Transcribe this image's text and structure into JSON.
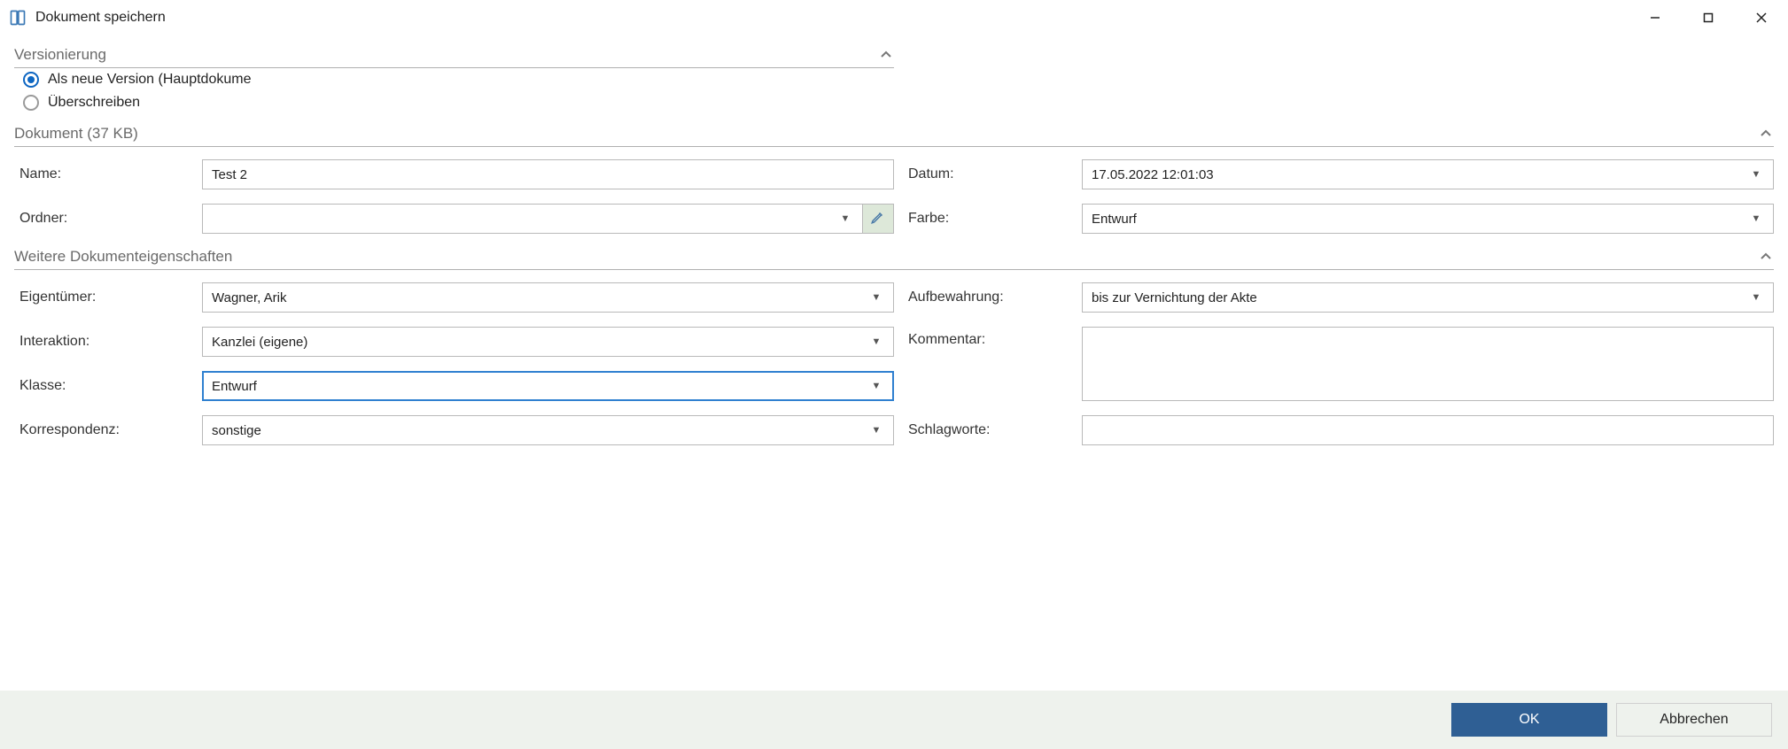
{
  "window": {
    "title": "Dokument speichern"
  },
  "versioning": {
    "title": "Versionierung",
    "option_new_version": "Als neue Version (Hauptdokume",
    "option_overwrite": "Überschreiben"
  },
  "document": {
    "title": "Dokument (37 KB)",
    "labels": {
      "name": "Name:",
      "folder": "Ordner:",
      "date": "Datum:",
      "color": "Farbe:"
    },
    "values": {
      "name": "Test 2",
      "folder": "",
      "date": "17.05.2022 12:01:03",
      "color": "Entwurf"
    }
  },
  "props": {
    "title": "Weitere Dokumenteigenschaften",
    "labels": {
      "owner": "Eigentümer:",
      "interaction": "Interaktion:",
      "class": "Klasse:",
      "correspondence": "Korrespondenz:",
      "retention": "Aufbewahrung:",
      "comment": "Kommentar:",
      "tags": "Schlagworte:"
    },
    "values": {
      "owner": "Wagner, Arik",
      "interaction": "Kanzlei (eigene)",
      "class": "Entwurf",
      "correspondence": "sonstige",
      "retention": "bis zur Vernichtung der Akte",
      "comment": "",
      "tags": ""
    }
  },
  "buttons": {
    "ok": "OK",
    "cancel": "Abbrechen"
  }
}
